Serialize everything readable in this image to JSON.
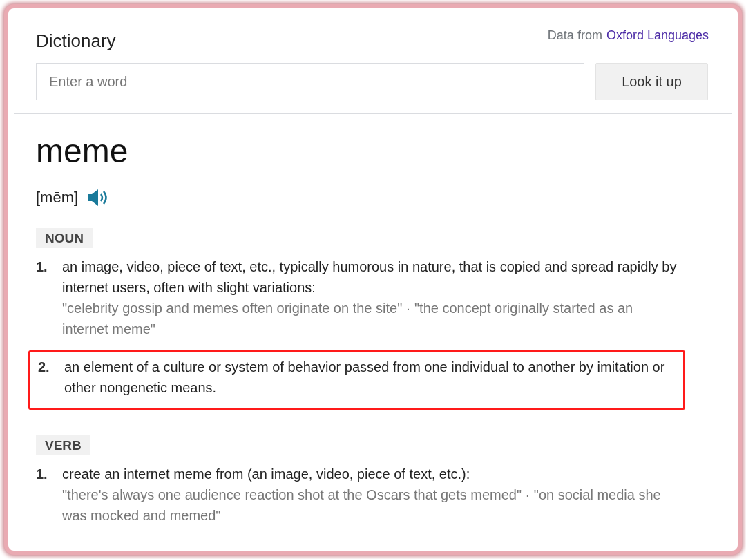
{
  "header": {
    "title": "Dictionary",
    "source_prefix": "Data from",
    "source_link": "Oxford Languages"
  },
  "search": {
    "placeholder": "Enter a word",
    "button": "Look it up"
  },
  "entry": {
    "word": "meme",
    "pronunciation": "[mēm]"
  },
  "groups": [
    {
      "pos": "NOUN",
      "senses": [
        {
          "number": "1.",
          "definition": "an image, video, piece of text, etc., typically humorous in nature, that is copied and spread rapidly by internet users, often with slight variations:",
          "examples": "\"celebrity gossip and memes often originate on the site\" · \"the concept originally started as an internet meme\"",
          "highlighted": false
        },
        {
          "number": "2.",
          "definition": "an element of a culture or system of behavior passed from one individual to another by imitation or other nongenetic means.",
          "highlighted": true
        }
      ]
    },
    {
      "pos": "VERB",
      "senses": [
        {
          "number": "1.",
          "definition": "create an internet meme from (an image, video, piece of text, etc.):",
          "examples": "\"there's always one audience reaction shot at the Oscars that gets memed\" · \"on social media she was mocked and memed\"",
          "highlighted": false
        }
      ]
    }
  ]
}
